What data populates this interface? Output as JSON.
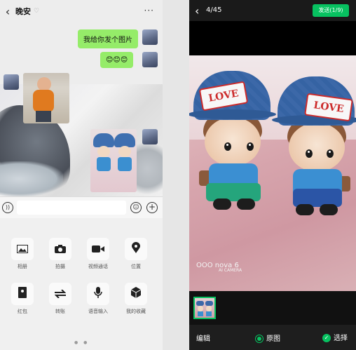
{
  "chat": {
    "title": "晚安",
    "title_suffix": "♡",
    "more": "···",
    "messages": [
      {
        "side": "right",
        "type": "text",
        "text": "我给你发个图片"
      },
      {
        "side": "right",
        "type": "text",
        "text": "😊😊😊"
      },
      {
        "side": "left",
        "type": "image",
        "content": "child-photo"
      },
      {
        "side": "right",
        "type": "image",
        "content": "dolls-photo"
      }
    ],
    "input_placeholder": "",
    "panel_items": [
      {
        "label": "相册",
        "icon": "photo-album-icon"
      },
      {
        "label": "拍摄",
        "icon": "camera-icon"
      },
      {
        "label": "视频通话",
        "icon": "video-call-icon"
      },
      {
        "label": "位置",
        "icon": "location-icon"
      },
      {
        "label": "红包",
        "icon": "red-packet-icon"
      },
      {
        "label": "转账",
        "icon": "transfer-icon"
      },
      {
        "label": "语音输入",
        "icon": "voice-input-icon"
      },
      {
        "label": "我的收藏",
        "icon": "favorites-icon"
      }
    ],
    "pager": "● ●"
  },
  "picker": {
    "back": "‹",
    "count": "4/45",
    "send_label": "发送(1/9)",
    "photo_patch_left": "LOVE",
    "photo_patch_right": "LOVE",
    "watermark": "OOO nova 6",
    "watermark_sub": "AI CAMERA",
    "edit_label": "编辑",
    "original_label": "原图",
    "select_label": "选择",
    "accent": "#07c160"
  }
}
